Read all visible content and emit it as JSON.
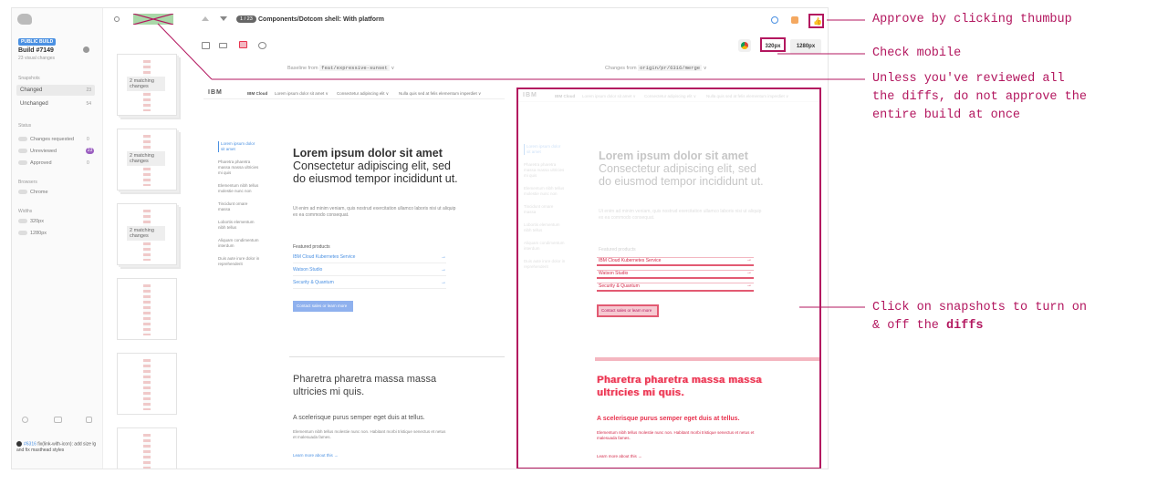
{
  "sidebar": {
    "badge": "PUBLIC BUILD",
    "build_title": "Build #7149",
    "build_sub": "23 visual changes",
    "snapshots_label": "Snapshots",
    "changed_label": "Changed",
    "changed_count": "23",
    "unchanged_label": "Unchanged",
    "unchanged_count": "54",
    "status_label": "Status",
    "changes_requested_label": "Changes requested",
    "changes_requested_count": "0",
    "unreviewed_label": "Unreviewed",
    "unreviewed_count": "23",
    "approved_label": "Approved",
    "approved_count": "0",
    "browsers_label": "Browsers",
    "browser_chrome": "Chrome",
    "widths_label": "Widths",
    "width_320": "320px",
    "width_1280": "1280px",
    "pr_link": "#6316",
    "pr_text": " fix(link-with-icon): add size lg and fix masthead styles"
  },
  "thumbs": {
    "matching_1": "2 matching changes",
    "matching_2": "2 matching changes",
    "matching_3": "2 matching changes"
  },
  "toolbar": {
    "counter": "1 / 23",
    "story_title": "Components/Dotcom shell: With platform",
    "width_320": "320px",
    "width_1280": "1280px",
    "baseline_from": "Baseline from",
    "baseline_branch": "feat/expressive-sunset",
    "baseline_time": "an hour ago",
    "changes_from": "Changes from",
    "changes_branch": "origin/pr/6316/merge",
    "changes_time": "23 minutes ago"
  },
  "page": {
    "ibm": "IBM",
    "cloud": "IBM Cloud",
    "nav_1": "Lorem ipsum dolor sit amet ∨",
    "nav_2": "Consectetur adipiscing elit ∨",
    "nav_3": "Nulla quis sed at felis elementum imperdiet ∨",
    "side_1": "Lorem ipsum dolor sit amet",
    "side_2": "Pharetra pharetra massa massa ultricies mi quis",
    "side_3": "Elementum nibh tellus molestie nunc non",
    "side_4": "Tincidunt ornare massa",
    "side_5": "Lobortis elementum nibh tellus",
    "side_6": "Aliquam condimentum interdum",
    "side_7": "Duis aute irure dolor in reprehenderit",
    "h1_bold": "Lorem ipsum dolor sit amet",
    "h1_rest": "Consectetur adipiscing elit, sed do eiusmod tempor incididunt ut.",
    "para": "Ut enim ad minim veniam, quis nostrud exercitation ullamco laboris nisi ut aliquip ex ea commodo consequat.",
    "featured": "Featured products",
    "link_1": "IBM Cloud Kubernetes Service",
    "link_2": "Watson Studio",
    "link_3": "Security & Quantum",
    "cta": "Contact sales or learn more",
    "h2": "Pharetra pharetra massa massa ultricies mi quis.",
    "h3": "A scelerisque purus semper eget duis at tellus.",
    "para2": "Elementum nibh tellus molestie nunc non. Habitant morbi tristique senectus et netus et malesuada fames.",
    "learn": "Learn more about this →"
  },
  "annotations": {
    "approve": "Approve by clicking thumbup",
    "check_mobile": "Check mobile",
    "review_warning": "Unless you've reviewed all the diffs, do not approve the entire build at once",
    "click_prefix": "Click on snapshots to turn on & off the ",
    "click_bold": "diffs"
  },
  "icons": [
    "logo-icon",
    "search-icon",
    "arrow-up-icon",
    "arrow-down-icon",
    "comment-icon",
    "layers-icon",
    "thumbs-up-icon",
    "grid-view-icon",
    "single-view-icon",
    "diff-view-icon",
    "zoom-icon",
    "chrome-icon",
    "settings-icon",
    "keyboard-icon",
    "help-icon",
    "github-icon"
  ],
  "colors": {
    "accent": "#b3175f",
    "approve_green": "#3aa73a",
    "diff_red": "#e8334f",
    "link_blue": "#4a90e2"
  }
}
